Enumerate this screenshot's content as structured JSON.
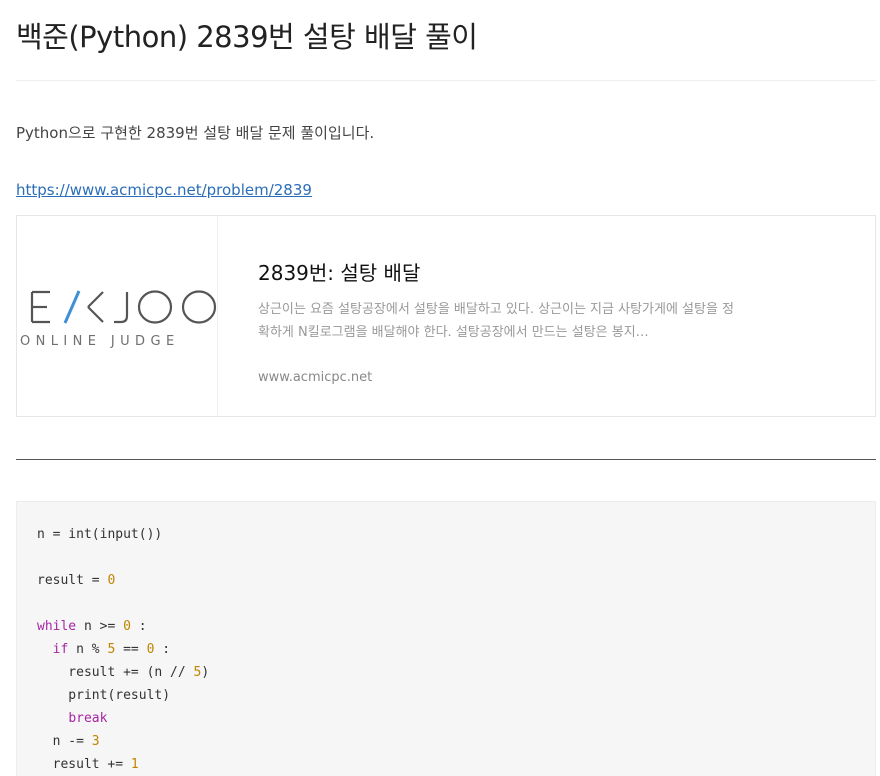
{
  "post": {
    "title": "백준(Python) 2839번 설탕 배달 풀이",
    "intro": "Python으로 구현한 2839번 설탕 배달 문제 풀이입니다.",
    "link": "https://www.acmicpc.net/problem/2839"
  },
  "card": {
    "logo_text": "BAEKJOON ONLINE JUDGE",
    "title": "2839번: 설탕 배달",
    "description": "상근이는 요즘 설탕공장에서 설탕을 배달하고 있다. 상근이는 지금 사탕가게에 설탕을 정확하게 N킬로그램을 배달해야 한다. 설탕공장에서 만드는 설탕은 봉지…",
    "domain": "www.acmicpc.net"
  },
  "code": {
    "language": "python",
    "lines": [
      "n = int(input())",
      "",
      "result = 0",
      "",
      "while n >= 0 :",
      "  if n % 5 == 0 :",
      "    result += (n // 5)",
      "    print(result)",
      "    break",
      "  n -= 3",
      "  result += 1"
    ]
  },
  "colors": {
    "link": "#2a6db8",
    "keyword": "#a626a4",
    "number": "#c18401",
    "logo_accent": "#3d8fd6",
    "code_background": "#f6f6f6"
  }
}
